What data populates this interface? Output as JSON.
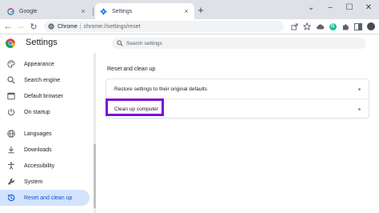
{
  "browser": {
    "tabs": [
      {
        "title": "Google",
        "close": "×",
        "active": false
      },
      {
        "title": "Settings",
        "close": "×",
        "active": true
      }
    ],
    "new_tab": "+",
    "window_controls": {
      "collapse": "⌄",
      "minimize": "–",
      "maximize": "☐",
      "close": "✕"
    },
    "nav": {
      "back": "←",
      "forward": "→",
      "reload": "↻"
    },
    "omnibox": {
      "site_name": "Chrome",
      "separator": "|",
      "url": "chrome://settings/reset"
    },
    "toolbar_icons": [
      "share-icon",
      "bookmark-star-icon",
      "cloud-extension-icon",
      "grammarly-extension-icon",
      "extensions-puzzle-icon",
      "reading-list-icon",
      "avatar",
      "menu-kebab-icon"
    ],
    "grammarly_letter": "G",
    "colors": {
      "tabstrip": "#dee1e6",
      "active_nav": "#d3e3fd",
      "accent_text": "#0b57d0",
      "highlight_box": "#7a0ddb"
    }
  },
  "header": {
    "title": "Settings",
    "search_placeholder": "Search settings"
  },
  "sidebar": {
    "items": [
      {
        "label": "Appearance",
        "icon": "palette-icon"
      },
      {
        "label": "Search engine",
        "icon": "search-icon"
      },
      {
        "label": "Default browser",
        "icon": "browser-window-icon"
      },
      {
        "label": "On startup",
        "icon": "power-icon"
      },
      {
        "label": "Languages",
        "icon": "globe-icon"
      },
      {
        "label": "Downloads",
        "icon": "download-icon"
      },
      {
        "label": "Accessibility",
        "icon": "accessibility-icon"
      },
      {
        "label": "System",
        "icon": "wrench-icon"
      },
      {
        "label": "Reset and clean up",
        "icon": "reset-history-icon",
        "active": true
      }
    ]
  },
  "main": {
    "section_title": "Reset and clean up",
    "rows": [
      {
        "label": "Restore settings to their original defaults",
        "arrow": "▸"
      },
      {
        "label": "Clean up computer",
        "arrow": "▸",
        "highlighted": true
      }
    ]
  }
}
